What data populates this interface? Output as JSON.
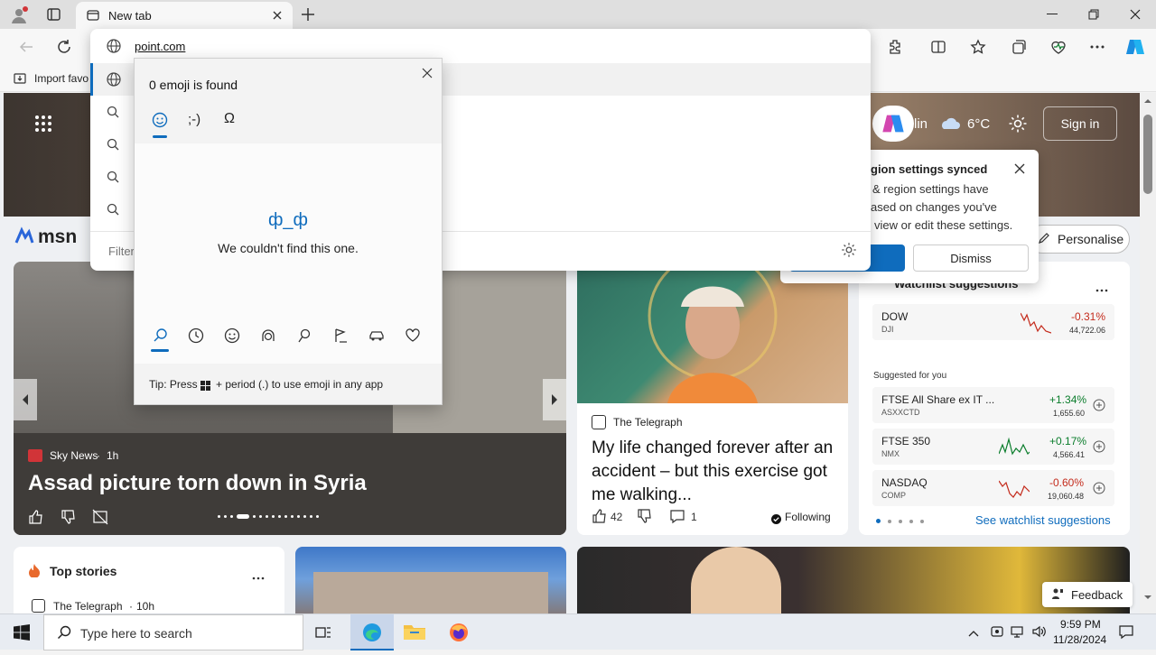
{
  "browser": {
    "tab_title": "New tab",
    "favorites_bar": {
      "import_label": "Import favo"
    },
    "address_text": "point.com"
  },
  "omnibox": {
    "filter_placeholder": "Filter"
  },
  "emoji_panel": {
    "status": "0 emoji is found",
    "tabs": [
      "emoji-tab",
      "kaomoji-tab",
      "symbols-tab"
    ],
    "kaomoji_tab_label": ";-)",
    "symbols_tab_label": "Ω",
    "not_found_face": "ф_ф",
    "not_found_text": "We couldn't find this one.",
    "tip_prefix": "Tip: Press",
    "tip_suffix": "+ period (.) to use emoji in any app"
  },
  "msn": {
    "logo": "msn",
    "weather_city": "lin",
    "weather_temp": "6°C",
    "sign_in": "Sign in",
    "personalise": "Personalise",
    "popover": {
      "title": "gion settings synced",
      "body_1": "& region settings have",
      "body_2": "ased on changes you've",
      "body_3": "view or edit these settings.",
      "dismiss": "Dismiss"
    },
    "hero": {
      "source": "Sky News",
      "age": "1h",
      "headline": "Assad picture torn down in Syria"
    },
    "story2": {
      "source": "The Telegraph",
      "headline": "My life changed forever after an accident – but this exercise got me walking...",
      "likes": "42",
      "comments": "1",
      "following": "Following"
    },
    "watchlist": {
      "title": "Watchlist suggestions",
      "suggested_label": "Suggested for you",
      "see_more": "See watchlist suggestions",
      "items": [
        {
          "name": "DOW",
          "symbol": "DJI",
          "change": "-0.31%",
          "price": "44,722.06",
          "up": false
        },
        {
          "name": "FTSE All Share ex IT ...",
          "symbol": "ASXXCTD",
          "change": "+1.34%",
          "price": "1,655.60",
          "up": true
        },
        {
          "name": "FTSE 350",
          "symbol": "NMX",
          "change": "+0.17%",
          "price": "4,566.41",
          "up": true
        },
        {
          "name": "NASDAQ",
          "symbol": "COMP",
          "change": "-0.60%",
          "price": "19,060.48",
          "up": false
        }
      ]
    },
    "top_stories": {
      "title": "Top stories",
      "first_source": "The Telegraph",
      "first_age": "10h"
    },
    "feedback": "Feedback"
  },
  "taskbar": {
    "search_placeholder": "Type here to search",
    "time": "9:59 PM",
    "date": "11/28/2024"
  },
  "colors": {
    "accent": "#0f6cbd",
    "positive": "#0b7d2c",
    "negative": "#c42b1c"
  }
}
